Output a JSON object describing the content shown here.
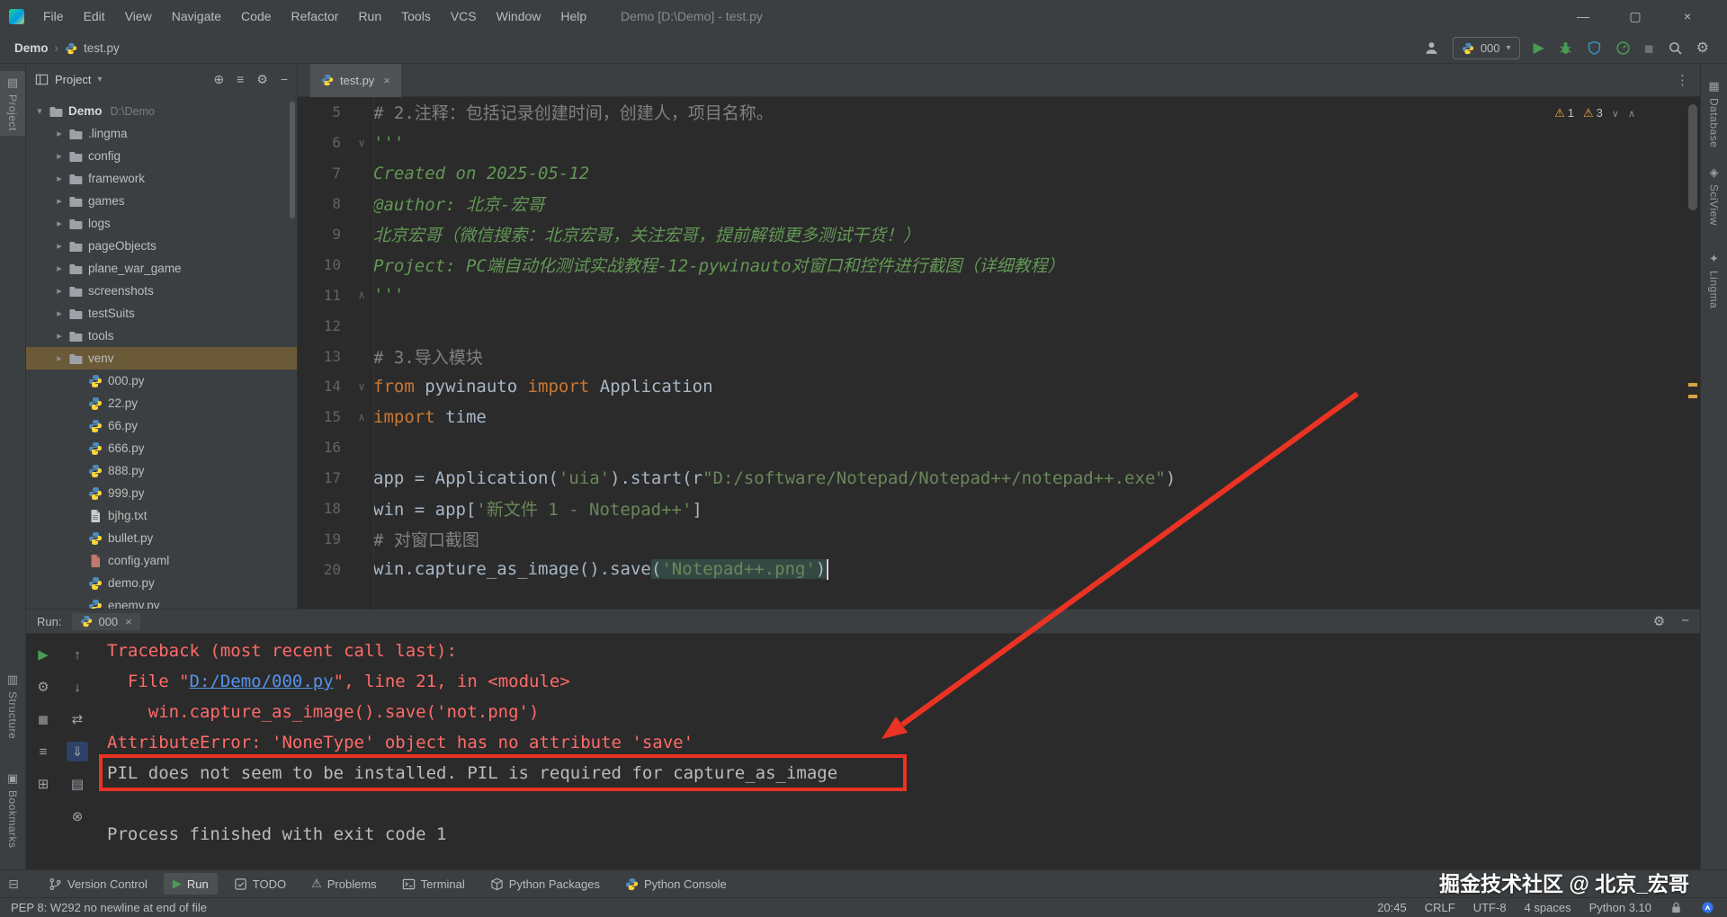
{
  "titlebar": {
    "menu": [
      "File",
      "Edit",
      "View",
      "Navigate",
      "Code",
      "Refactor",
      "Run",
      "Tools",
      "VCS",
      "Window",
      "Help"
    ],
    "title": "Demo [D:\\Demo] - test.py"
  },
  "navbar": {
    "breadcrumb_project": "Demo",
    "breadcrumb_separator": "›",
    "breadcrumb_file": "test.py",
    "run_config": "000"
  },
  "left_stripe": [
    {
      "label": "Project",
      "glyph": "▤",
      "active": true
    },
    {
      "label": "Structure",
      "glyph": "▥",
      "active": false
    },
    {
      "label": "Bookmarks",
      "glyph": "▣",
      "active": false
    }
  ],
  "right_stripe": [
    {
      "label": "Database",
      "glyph": "▦"
    },
    {
      "label": "SciView",
      "glyph": "◈"
    },
    {
      "label": "Lingma",
      "glyph": "✦"
    }
  ],
  "project_panel": {
    "title": "Project",
    "header_icons": [
      {
        "glyph": "⊕",
        "name": "locate-button"
      },
      {
        "glyph": "≡",
        "name": "collapse-all-button"
      },
      {
        "glyph": "⚙",
        "name": "panel-settings-button"
      },
      {
        "glyph": "−",
        "name": "hide-panel-button"
      }
    ],
    "tree": [
      {
        "label": "Demo",
        "extra": "D:\\Demo",
        "type": "folder",
        "level": 0,
        "chevron": "expanded",
        "bold": true
      },
      {
        "label": ".lingma",
        "type": "folder",
        "level": 1,
        "chevron": "collapsed"
      },
      {
        "label": "config",
        "type": "folder",
        "level": 1,
        "chevron": "collapsed"
      },
      {
        "label": "framework",
        "type": "folder",
        "level": 1,
        "chevron": "collapsed"
      },
      {
        "label": "games",
        "type": "folder",
        "level": 1,
        "chevron": "collapsed"
      },
      {
        "label": "logs",
        "type": "folder",
        "level": 1,
        "chevron": "collapsed"
      },
      {
        "label": "pageObjects",
        "type": "folder",
        "level": 1,
        "chevron": "collapsed"
      },
      {
        "label": "plane_war_game",
        "type": "folder",
        "level": 1,
        "chevron": "collapsed"
      },
      {
        "label": "screenshots",
        "type": "folder",
        "level": 1,
        "chevron": "collapsed"
      },
      {
        "label": "testSuits",
        "type": "folder",
        "level": 1,
        "chevron": "collapsed"
      },
      {
        "label": "tools",
        "type": "folder",
        "level": 1,
        "chevron": "collapsed"
      },
      {
        "label": "venv",
        "type": "folder",
        "level": 1,
        "chevron": "collapsed",
        "selected": true
      },
      {
        "label": "000.py",
        "type": "python",
        "level": 2
      },
      {
        "label": "22.py",
        "type": "python",
        "level": 2
      },
      {
        "label": "66.py",
        "type": "python",
        "level": 2
      },
      {
        "label": "666.py",
        "type": "python",
        "level": 2
      },
      {
        "label": "888.py",
        "type": "python",
        "level": 2
      },
      {
        "label": "999.py",
        "type": "python",
        "level": 2
      },
      {
        "label": "bjhg.txt",
        "type": "text",
        "level": 2
      },
      {
        "label": "bullet.py",
        "type": "python",
        "level": 2
      },
      {
        "label": "config.yaml",
        "type": "yaml",
        "level": 2
      },
      {
        "label": "demo.py",
        "type": "python",
        "level": 2
      },
      {
        "label": "enemy.py",
        "type": "python",
        "level": 2
      }
    ]
  },
  "editor": {
    "tab": "test.py",
    "inspections": [
      {
        "count": "1"
      },
      {
        "count": "3"
      }
    ],
    "lines": [
      {
        "num": "5",
        "segs": [
          {
            "c": "comment",
            "t": "# 2.注释：包括记录创建时间，创建人，项目名称。"
          }
        ]
      },
      {
        "num": "6",
        "fold": "start",
        "segs": [
          {
            "c": "doc",
            "t": "'''"
          }
        ]
      },
      {
        "num": "7",
        "segs": [
          {
            "c": "doc",
            "t": "Created on 2025-05-12"
          }
        ]
      },
      {
        "num": "8",
        "segs": [
          {
            "c": "doc",
            "t": "@author: 北京-宏哥"
          }
        ]
      },
      {
        "num": "9",
        "segs": [
          {
            "c": "doc",
            "t": "北京宏哥（微信搜索：北京宏哥，关注宏哥，提前解锁更多测试干货！）"
          }
        ]
      },
      {
        "num": "10",
        "segs": [
          {
            "c": "doc",
            "t": "Project: PC端自动化测试实战教程-12-pywinauto对窗口和控件进行截图（详细教程）"
          }
        ]
      },
      {
        "num": "11",
        "fold": "end",
        "segs": [
          {
            "c": "doc",
            "t": "'''"
          }
        ]
      },
      {
        "num": "12",
        "segs": []
      },
      {
        "num": "13",
        "segs": [
          {
            "c": "comment",
            "t": "# 3.导入模块"
          }
        ]
      },
      {
        "num": "14",
        "fold": "start",
        "segs": [
          {
            "c": "kw",
            "t": "from"
          },
          {
            "c": "plain",
            "t": " pywinauto "
          },
          {
            "c": "kw",
            "t": "import"
          },
          {
            "c": "plain",
            "t": " Application"
          }
        ]
      },
      {
        "num": "15",
        "fold": "end",
        "segs": [
          {
            "c": "kw",
            "t": "import"
          },
          {
            "c": "plain",
            "t": " time"
          }
        ]
      },
      {
        "num": "16",
        "segs": []
      },
      {
        "num": "17",
        "segs": [
          {
            "c": "plain",
            "t": "app = Application("
          },
          {
            "c": "str",
            "t": "'uia'"
          },
          {
            "c": "plain",
            "t": ").start(r"
          },
          {
            "c": "str",
            "t": "\"D:/software/Notepad/Notepad++/notepad++.exe\""
          },
          {
            "c": "plain",
            "t": ")"
          }
        ]
      },
      {
        "num": "18",
        "segs": [
          {
            "c": "plain",
            "t": "win = app["
          },
          {
            "c": "str",
            "t": "'新文件 1 - Notepad++'"
          },
          {
            "c": "plain",
            "t": "]"
          }
        ]
      },
      {
        "num": "19",
        "segs": [
          {
            "c": "comment",
            "t": "# 对窗口截图"
          }
        ]
      },
      {
        "num": "20",
        "segs": [
          {
            "c": "plain",
            "t": "win.capture_as_image().save"
          },
          {
            "c": "plain",
            "t": "(",
            "h": true
          },
          {
            "c": "str",
            "t": "'Notepad++.png'",
            "h": true
          },
          {
            "c": "plain",
            "t": ")",
            "h": true
          },
          {
            "caret": true
          }
        ]
      }
    ]
  },
  "run_panel": {
    "label": "Run:",
    "tab": "000",
    "toolbar_a": [
      {
        "glyph": "▶",
        "name": "rerun-button",
        "color": "#499c54"
      },
      {
        "glyph": "⚙",
        "name": "run-settings-button"
      },
      {
        "glyph": "◼",
        "name": "stop-button",
        "color": "#777b7d"
      },
      {
        "glyph": "≡",
        "name": "run-menu-button"
      },
      {
        "glyph": "⊞",
        "name": "pin-tab-button"
      }
    ],
    "toolbar_b": [
      {
        "glyph": "↑",
        "name": "prev-stacktrace-button"
      },
      {
        "glyph": "↓",
        "name": "next-stacktrace-button"
      },
      {
        "glyph": "⇄",
        "name": "soft-wrap-button"
      },
      {
        "glyph": "⇓",
        "name": "scroll-to-end-button",
        "active": true
      },
      {
        "glyph": "▤",
        "name": "print-button"
      },
      {
        "glyph": "⊗",
        "name": "clear-console-button"
      }
    ],
    "console": [
      {
        "segs": [
          {
            "c": "err",
            "t": "Traceback (most recent call last):"
          }
        ]
      },
      {
        "segs": [
          {
            "c": "err",
            "t": "  File \""
          },
          {
            "c": "link",
            "t": "D:/Demo/000.py"
          },
          {
            "c": "err",
            "t": "\", line 21, in <module>"
          }
        ]
      },
      {
        "segs": [
          {
            "c": "err",
            "t": "    win.capture_as_image().save('not.png')"
          }
        ]
      },
      {
        "segs": [
          {
            "c": "err",
            "t": "AttributeError: 'NoneType' object has no attribute 'save'"
          }
        ]
      },
      {
        "segs": [
          {
            "c": "out",
            "t": "PIL does not seem to be installed. PIL is required for capture_as_image"
          }
        ]
      },
      {
        "segs": []
      },
      {
        "segs": [
          {
            "c": "out",
            "t": "Process finished with exit code 1"
          }
        ]
      }
    ]
  },
  "bottom_bar": [
    {
      "icon": "branch",
      "label": "Version Control"
    },
    {
      "icon": "play",
      "label": "Run",
      "active": true
    },
    {
      "icon": "todo",
      "label": "TODO"
    },
    {
      "icon": "warning",
      "label": "Problems"
    },
    {
      "icon": "terminal",
      "label": "Terminal"
    },
    {
      "icon": "package",
      "label": "Python Packages"
    },
    {
      "icon": "python",
      "label": "Python Console"
    }
  ],
  "status_bar": {
    "left": "PEP 8: W292 no newline at end of file",
    "items": [
      "20:45",
      "CRLF",
      "UTF-8",
      "4 spaces",
      "Python 3.10"
    ]
  },
  "watermark": "掘金技术社区 @ 北京_宏哥"
}
